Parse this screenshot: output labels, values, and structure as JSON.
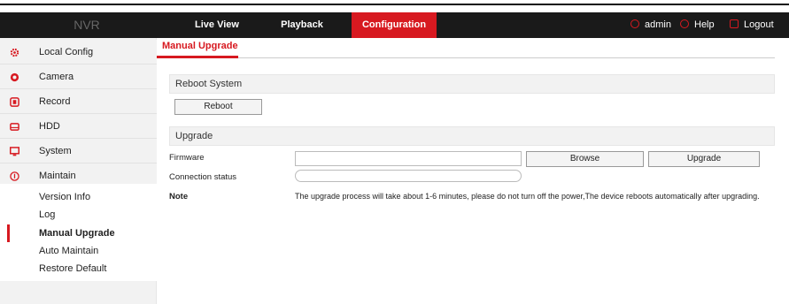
{
  "header": {
    "brand": "NVR",
    "nav": [
      {
        "label": "Live View",
        "active": false
      },
      {
        "label": "Playback",
        "active": false
      },
      {
        "label": "Configuration",
        "active": true
      }
    ],
    "user": "admin",
    "help": "Help",
    "logout": "Logout"
  },
  "sidebar": {
    "items": [
      {
        "label": "Local Config",
        "icon": "gear-icon"
      },
      {
        "label": "Camera",
        "icon": "camera-icon"
      },
      {
        "label": "Record",
        "icon": "record-icon"
      },
      {
        "label": "HDD",
        "icon": "hdd-icon"
      },
      {
        "label": "System",
        "icon": "monitor-icon"
      },
      {
        "label": "Maintain",
        "icon": "info-icon"
      }
    ],
    "maintain_subitems": [
      {
        "label": "Version Info",
        "active": false
      },
      {
        "label": "Log",
        "active": false
      },
      {
        "label": "Manual Upgrade",
        "active": true
      },
      {
        "label": "Auto Maintain",
        "active": false
      },
      {
        "label": "Restore Default",
        "active": false
      }
    ]
  },
  "main": {
    "tab": "Manual Upgrade",
    "reboot_section": {
      "title": "Reboot System",
      "button": "Reboot"
    },
    "upgrade_section": {
      "title": "Upgrade",
      "firmware_label": "Firmware",
      "firmware_value": "",
      "browse_button": "Browse",
      "upgrade_button": "Upgrade",
      "connection_label": "Connection status",
      "connection_progress": 0,
      "note_label": "Note",
      "note_text": "The upgrade process will take about 1-6 minutes, please do not turn off the power,The device reboots automatically after upgrading."
    }
  },
  "colors": {
    "accent": "#d71920",
    "topbar": "#1a1a1a",
    "sidebar": "#f2f2f2"
  }
}
